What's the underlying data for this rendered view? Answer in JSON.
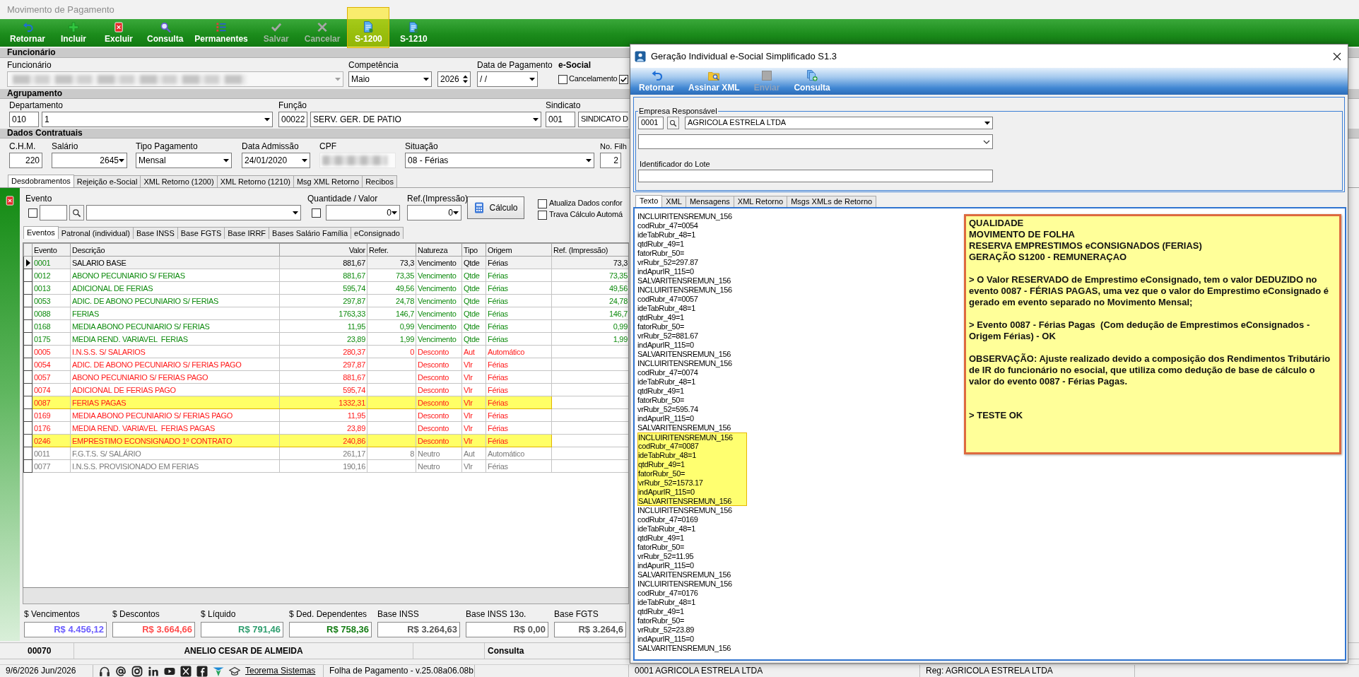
{
  "window": {
    "title": "Movimento de Pagamento"
  },
  "toolbar": [
    {
      "label": "Retornar",
      "disabled": false,
      "highlighted": false
    },
    {
      "label": "Incluir",
      "disabled": false,
      "highlighted": false
    },
    {
      "label": "Excluir",
      "disabled": false,
      "highlighted": false
    },
    {
      "label": "Consulta",
      "disabled": false,
      "highlighted": false
    },
    {
      "label": "Permanentes",
      "disabled": false,
      "highlighted": false
    },
    {
      "label": "Salvar",
      "disabled": true,
      "highlighted": false
    },
    {
      "label": "Cancelar",
      "disabled": true,
      "highlighted": false
    },
    {
      "label": "S-1200",
      "disabled": false,
      "highlighted": true
    },
    {
      "label": "S-1210",
      "disabled": false,
      "highlighted": false
    }
  ],
  "funcionario_section": {
    "title": "Funcionário",
    "employee_label": "Funcionário",
    "competencia": {
      "label": "Competência",
      "month": "Maio",
      "year": "2026"
    },
    "data_pagamento": {
      "label": "Data de Pagamento",
      "value": "/ /"
    },
    "esocial": {
      "label": "e-Social",
      "options": [
        {
          "label": "Cancelamento",
          "checked": false
        },
        {
          "checked": true
        }
      ]
    }
  },
  "agrupamento_section": {
    "title": "Agrupamento",
    "fields": [
      {
        "label": "Departamento",
        "code": "010",
        "name": "1",
        "kind": "select"
      },
      {
        "label": "Função",
        "code": "00022",
        "name": "SERV. GER. DE PATIO",
        "kind": "select"
      },
      {
        "label": "Sindicato",
        "code": "001",
        "name": "SINDICATO D",
        "kind": "text"
      }
    ]
  },
  "contratuais_section": {
    "title": "Dados Contratuais",
    "fields": [
      {
        "label": "C.H.M.",
        "value": "220",
        "kind": "number"
      },
      {
        "label": "Salário",
        "value": "2645",
        "kind": "numselect"
      },
      {
        "label": "Tipo Pagamento",
        "value": "Mensal",
        "kind": "select"
      },
      {
        "label": "Data Admissão",
        "value": "24/01/2020",
        "kind": "select"
      },
      {
        "label": "CPF",
        "kind": "blurred"
      },
      {
        "label": "Situação",
        "value": "08 - Férias",
        "kind": "select"
      },
      {
        "label": "No. Filh",
        "value": "2",
        "kind": "number"
      }
    ]
  },
  "tabs": [
    {
      "label": "Desdobramentos",
      "selected": true
    },
    {
      "label": "Rejeição e-Social",
      "selected": false
    },
    {
      "label": "XML Retorno (1200)",
      "selected": false
    },
    {
      "label": "XML Retorno (1210)",
      "selected": false
    },
    {
      "label": "Msg XML Retorno",
      "selected": false
    },
    {
      "label": "Recibos",
      "selected": false
    }
  ],
  "evento_form": {
    "evento_label": "Evento",
    "evento_checked": false,
    "quantidade_label": "Quantidade / Valor",
    "quantidade_checked": false,
    "quantidade_value": "0",
    "ref_label": "Ref.(Impressão)",
    "ref_value": "0",
    "calculo_button": "Cálculo",
    "options": [
      {
        "label": "Atualiza Dados confor",
        "checked": false
      },
      {
        "label": "Trava Cálculo Automá",
        "checked": false
      }
    ]
  },
  "subtabs": [
    {
      "label": "Eventos",
      "selected": true
    },
    {
      "label": "Patronal (individual)",
      "selected": false
    },
    {
      "label": "Base INSS",
      "selected": false
    },
    {
      "label": "Base FGTS",
      "selected": false
    },
    {
      "label": "Base IRRF",
      "selected": false
    },
    {
      "label": "Bases Salário Família",
      "selected": false
    },
    {
      "label": "eConsignado",
      "selected": false
    }
  ],
  "table": {
    "columns": [
      "Evento",
      "Descrição",
      "Valor",
      "Refer.",
      "Natureza",
      "Tipo",
      "Origem",
      "Ref. (Impressão)"
    ],
    "rows": [
      {
        "kind": "vencimento",
        "selected": true,
        "highlighted": false,
        "evento": "0001",
        "descricao": "SALARIO BASE",
        "valor": "881,67",
        "refer": "73,3",
        "natureza": "Vencimento",
        "tipo": "Qtde",
        "origem": "Férias",
        "ref_impressao": "73,3"
      },
      {
        "kind": "vencimento",
        "selected": false,
        "highlighted": false,
        "evento": "0012",
        "descricao": "ABONO PECUNIARIO S/ FERIAS",
        "valor": "881,67",
        "refer": "73,35",
        "natureza": "Vencimento",
        "tipo": "Qtde",
        "origem": "Férias",
        "ref_impressao": "73,35"
      },
      {
        "kind": "vencimento",
        "selected": false,
        "highlighted": false,
        "evento": "0013",
        "descricao": "ADICIONAL DE FERIAS",
        "valor": "595,74",
        "refer": "49,56",
        "natureza": "Vencimento",
        "tipo": "Qtde",
        "origem": "Férias",
        "ref_impressao": "49,56"
      },
      {
        "kind": "vencimento",
        "selected": false,
        "highlighted": false,
        "evento": "0053",
        "descricao": "ADIC. DE ABONO PECUNIARIO S/ FERIAS",
        "valor": "297,87",
        "refer": "24,78",
        "natureza": "Vencimento",
        "tipo": "Qtde",
        "origem": "Férias",
        "ref_impressao": "24,78"
      },
      {
        "kind": "vencimento",
        "selected": false,
        "highlighted": false,
        "evento": "0088",
        "descricao": "FERIAS",
        "valor": "1763,33",
        "refer": "146,7",
        "natureza": "Vencimento",
        "tipo": "Qtde",
        "origem": "Férias",
        "ref_impressao": "146,7"
      },
      {
        "kind": "vencimento",
        "selected": false,
        "highlighted": false,
        "evento": "0168",
        "descricao": "MEDIA ABONO PECUNIARIO S/ FERIAS",
        "valor": "11,95",
        "refer": "0,99",
        "natureza": "Vencimento",
        "tipo": "Qtde",
        "origem": "Férias",
        "ref_impressao": "0,99"
      },
      {
        "kind": "vencimento",
        "selected": false,
        "highlighted": false,
        "evento": "0175",
        "descricao": "MEDIA REND. VARIAVEL  FERIAS",
        "valor": "23,89",
        "refer": "1,99",
        "natureza": "Vencimento",
        "tipo": "Qtde",
        "origem": "Férias",
        "ref_impressao": "1,99"
      },
      {
        "kind": "desconto",
        "selected": false,
        "highlighted": false,
        "evento": "0005",
        "descricao": "I.N.S.S. S/ SALARIOS",
        "valor": "280,37",
        "refer": "0",
        "natureza": "Desconto",
        "tipo": "Aut",
        "origem": "Automático"
      },
      {
        "kind": "desconto",
        "selected": false,
        "highlighted": false,
        "evento": "0054",
        "descricao": "ADIC. DE ABONO PECUNIARIO S/ FERIAS PAGO",
        "valor": "297,87",
        "natureza": "Desconto",
        "tipo": "Vlr",
        "origem": "Férias"
      },
      {
        "kind": "desconto",
        "selected": false,
        "highlighted": false,
        "evento": "0057",
        "descricao": "ABONO PECUNIARIO S/ FERIAS PAGO",
        "valor": "881,67",
        "natureza": "Desconto",
        "tipo": "Vlr",
        "origem": "Férias"
      },
      {
        "kind": "desconto",
        "selected": false,
        "highlighted": false,
        "evento": "0074",
        "descricao": "ADICIONAL DE FERIAS PAGO",
        "valor": "595,74",
        "natureza": "Desconto",
        "tipo": "Vlr",
        "origem": "Férias"
      },
      {
        "kind": "desconto",
        "selected": false,
        "highlighted": true,
        "evento": "0087",
        "descricao": "FERIAS PAGAS",
        "valor": "1332,31",
        "natureza": "Desconto",
        "tipo": "Vlr",
        "origem": "Férias"
      },
      {
        "kind": "desconto",
        "selected": false,
        "highlighted": false,
        "evento": "0169",
        "descricao": "MEDIA ABONO PECUNIARIO S/ FERIAS PAGO",
        "valor": "11,95",
        "natureza": "Desconto",
        "tipo": "Vlr",
        "origem": "Férias"
      },
      {
        "kind": "desconto",
        "selected": false,
        "highlighted": false,
        "evento": "0176",
        "descricao": "MEDIA REND. VARIAVEL  FERIAS PAGAS",
        "valor": "23,89",
        "natureza": "Desconto",
        "tipo": "Vlr",
        "origem": "Férias"
      },
      {
        "kind": "desconto",
        "selected": false,
        "highlighted": true,
        "evento": "0246",
        "descricao": "EMPRESTIMO ECONSIGNADO 1º CONTRATO",
        "valor": "240,86",
        "natureza": "Desconto",
        "tipo": "Vlr",
        "origem": "Férias"
      },
      {
        "kind": "neutro",
        "selected": false,
        "highlighted": false,
        "evento": "0011",
        "descricao": "F.G.T.S. S/ SALÁRIO",
        "valor": "261,17",
        "refer": "8",
        "natureza": "Neutro",
        "tipo": "Aut",
        "origem": "Automático"
      },
      {
        "kind": "neutro",
        "selected": false,
        "highlighted": false,
        "evento": "0077",
        "descricao": "I.N.S.S. PROVISIONADO EM FERIAS",
        "valor": "190,16",
        "natureza": "Neutro",
        "tipo": "Vlr",
        "origem": "Férias"
      }
    ]
  },
  "totals": [
    {
      "label": "$ Vencimentos",
      "value": "R$ 4.456,12",
      "color": "#6a5cff"
    },
    {
      "label": "$ Descontos",
      "value": "R$ 3.664,66",
      "color": "#ff4d4d"
    },
    {
      "label": "$ Líquido",
      "value": "R$ 791,46",
      "color": "#2f9e6f"
    },
    {
      "label": "$ Ded. Dependentes",
      "value": "R$ 758,36",
      "color": "#137c13"
    },
    {
      "label": "Base INSS",
      "value": "R$ 3.264,63",
      "color": "#555555"
    },
    {
      "label": "Base INSS 13o.",
      "value": "R$ 0,00",
      "color": "#555555"
    },
    {
      "label": "Base FGTS",
      "value": "R$ 3.264,6",
      "color": "#555555"
    }
  ],
  "record_bar": {
    "code": "00070",
    "name": "ANELIO CESAR DE ALMEIDA",
    "mode": "Consulta"
  },
  "status_bar": {
    "date": "9/6/2026 Jun/2026",
    "link": "Teorema Sistemas",
    "version": "Folha de Pagamento - v.25.08a06.08b",
    "company": "0001 AGRICOLA ESTRELA LTDA",
    "registry": "Reg: AGRICOLA ESTRELA LTDA"
  },
  "dialog": {
    "title": "Geração Individual e-Social Simplificado S1.3",
    "toolbar": [
      {
        "label": "Retornar",
        "disabled": false
      },
      {
        "label": "Assinar XML",
        "disabled": false
      },
      {
        "label": "Enviar",
        "disabled": true
      },
      {
        "label": "Consulta",
        "disabled": false
      }
    ],
    "empresa": {
      "title": "Empresa Responsável",
      "code": "0001",
      "name": "AGRICOLA ESTRELA LTDA"
    },
    "lote_label": "Identificador do Lote",
    "tabs": [
      {
        "label": "Texto",
        "selected": true
      },
      {
        "label": "XML",
        "selected": false
      },
      {
        "label": "Mensagens",
        "selected": false
      },
      {
        "label": "XML Retorno",
        "selected": false
      },
      {
        "label": "Msgs XMLs de Retorno",
        "selected": false
      }
    ],
    "lines": [
      {
        "text": "INCLUIRITENSREMUN_156",
        "highlighted": false
      },
      {
        "text": "codRubr_47=0054",
        "highlighted": false
      },
      {
        "text": "ideTabRubr_48=1",
        "highlighted": false
      },
      {
        "text": "qtdRubr_49=1",
        "highlighted": false
      },
      {
        "text": "fatorRubr_50=",
        "highlighted": false
      },
      {
        "text": "vrRubr_52=297.87",
        "highlighted": false
      },
      {
        "text": "indApurIR_115=0",
        "highlighted": false
      },
      {
        "text": "SALVARITENSREMUN_156",
        "highlighted": false
      },
      {
        "text": "INCLUIRITENSREMUN_156",
        "highlighted": false
      },
      {
        "text": "codRubr_47=0057",
        "highlighted": false
      },
      {
        "text": "ideTabRubr_48=1",
        "highlighted": false
      },
      {
        "text": "qtdRubr_49=1",
        "highlighted": false
      },
      {
        "text": "fatorRubr_50=",
        "highlighted": false
      },
      {
        "text": "vrRubr_52=881.67",
        "highlighted": false
      },
      {
        "text": "indApurIR_115=0",
        "highlighted": false
      },
      {
        "text": "SALVARITENSREMUN_156",
        "highlighted": false
      },
      {
        "text": "INCLUIRITENSREMUN_156",
        "highlighted": false
      },
      {
        "text": "codRubr_47=0074",
        "highlighted": false
      },
      {
        "text": "ideTabRubr_48=1",
        "highlighted": false
      },
      {
        "text": "qtdRubr_49=1",
        "highlighted": false
      },
      {
        "text": "fatorRubr_50=",
        "highlighted": false
      },
      {
        "text": "vrRubr_52=595.74",
        "highlighted": false
      },
      {
        "text": "indApurIR_115=0",
        "highlighted": false
      },
      {
        "text": "SALVARITENSREMUN_156",
        "highlighted": false
      },
      {
        "text": "INCLUIRITENSREMUN_156",
        "highlighted": true
      },
      {
        "text": "codRubr_47=0087",
        "highlighted": true
      },
      {
        "text": "ideTabRubr_48=1",
        "highlighted": true
      },
      {
        "text": "qtdRubr_49=1",
        "highlighted": true
      },
      {
        "text": "fatorRubr_50=",
        "highlighted": true
      },
      {
        "text": "vrRubr_52=1573.17",
        "highlighted": true
      },
      {
        "text": "indApurIR_115=0",
        "highlighted": true
      },
      {
        "text": "SALVARITENSREMUN_156",
        "highlighted": true
      },
      {
        "text": "INCLUIRITENSREMUN_156",
        "highlighted": false
      },
      {
        "text": "codRubr_47=0169",
        "highlighted": false
      },
      {
        "text": "ideTabRubr_48=1",
        "highlighted": false
      },
      {
        "text": "qtdRubr_49=1",
        "highlighted": false
      },
      {
        "text": "fatorRubr_50=",
        "highlighted": false
      },
      {
        "text": "vrRubr_52=11.95",
        "highlighted": false
      },
      {
        "text": "indApurIR_115=0",
        "highlighted": false
      },
      {
        "text": "SALVARITENSREMUN_156",
        "highlighted": false
      },
      {
        "text": "INCLUIRITENSREMUN_156",
        "highlighted": false
      },
      {
        "text": "codRubr_47=0176",
        "highlighted": false
      },
      {
        "text": "ideTabRubr_48=1",
        "highlighted": false
      },
      {
        "text": "qtdRubr_49=1",
        "highlighted": false
      },
      {
        "text": "fatorRubr_50=",
        "highlighted": false
      },
      {
        "text": "vrRubr_52=23.89",
        "highlighted": false
      },
      {
        "text": "indApurIR_115=0",
        "highlighted": false
      },
      {
        "text": "SALVARITENSREMUN_156",
        "highlighted": false
      }
    ],
    "note": {
      "heading": [
        "QUALIDADE",
        "MOVIMENTO DE FOLHA",
        "RESERVA EMPRESTIMOS eCONSIGNADOS (FERIAS)",
        "GERAÇÃO S1200 - REMUNERAÇAO"
      ],
      "paragraphs": [
        "> O Valor RESERVADO de Emprestimo eConsignado, tem o valor DEDUZIDO no evento 0087 - FÉRIAS PAGAS, uma vez que o valor do Emprestimo eConsignado é gerado em evento separado no Movimento Mensal;",
        "> Evento 0087 - Férias Pagas  (Com dedução de Emprestimos eConsignados - Origem Férias) - OK",
        "OBSERVAÇÃO: Ajuste realizado devido a composição dos Rendimentos Tributário de IR do funcionário no esocial, que utiliza como dedução de base de cálculo o valor do evento 0087 - Férias Pagas.",
        "> TESTE OK"
      ]
    }
  }
}
